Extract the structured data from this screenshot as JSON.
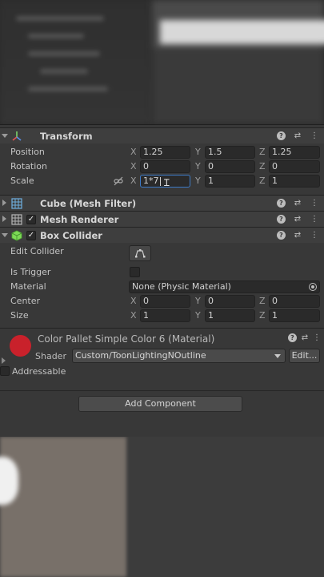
{
  "transform": {
    "title": "Transform",
    "position": {
      "label": "Position",
      "x": "1.25",
      "y": "1.5",
      "z": "1.25"
    },
    "rotation": {
      "label": "Rotation",
      "x": "0",
      "y": "0",
      "z": "0"
    },
    "scale": {
      "label": "Scale",
      "x": "1*7",
      "y": "1",
      "z": "1"
    }
  },
  "axes": {
    "x": "X",
    "y": "Y",
    "z": "Z"
  },
  "mesh_filter": {
    "title": "Cube (Mesh Filter)"
  },
  "mesh_renderer": {
    "title": "Mesh Renderer",
    "enabled": true
  },
  "box_collider": {
    "title": "Box Collider",
    "enabled": true,
    "edit_collider_label": "Edit Collider",
    "is_trigger_label": "Is Trigger",
    "material_label": "Material",
    "material_value": "None (Physic Material)",
    "center": {
      "label": "Center",
      "x": "0",
      "y": "0",
      "z": "0"
    },
    "size": {
      "label": "Size",
      "x": "1",
      "y": "1",
      "z": "1"
    }
  },
  "material": {
    "title": "Color Pallet Simple Color 6 (Material)",
    "shader_label": "Shader",
    "shader_value": "Custom/ToonLightingNOutline",
    "edit_label": "Edit...",
    "addressable_label": "Addressable",
    "swatch_color": "#c9212b"
  },
  "add_component_label": "Add Component",
  "icons": {
    "help": "help-icon",
    "presets": "presets-icon",
    "menu": "more-menu-icon",
    "check": "✓"
  }
}
